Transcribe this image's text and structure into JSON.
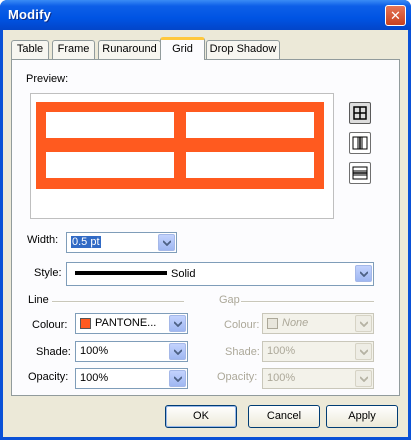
{
  "window": {
    "title": "Modify",
    "close_glyph": "✕"
  },
  "tabs": [
    {
      "label": "Table"
    },
    {
      "label": "Frame"
    },
    {
      "label": "Runaround"
    },
    {
      "label": "Grid"
    },
    {
      "label": "Drop Shadow"
    }
  ],
  "active_tab": "Grid",
  "preview": {
    "label": "Preview:",
    "grid_color": "#ff5a1f"
  },
  "width": {
    "label": "Width:",
    "value": "0.5 pt"
  },
  "style": {
    "label": "Style:",
    "value": "Solid"
  },
  "line": {
    "section_label": "Line",
    "colour": {
      "label": "Colour:",
      "value": "PANTONE...",
      "swatch": "#ff5a1f"
    },
    "shade": {
      "label": "Shade:",
      "value": "100%"
    },
    "opacity": {
      "label": "Opacity:",
      "value": "100%"
    }
  },
  "gap": {
    "section_label": "Gap",
    "colour": {
      "label": "Colour:",
      "value": "None"
    },
    "shade": {
      "label": "Shade:",
      "value": "100%"
    },
    "opacity": {
      "label": "Opacity:",
      "value": "100%"
    }
  },
  "buttons": {
    "ok": "OK",
    "cancel": "Cancel",
    "apply": "Apply"
  }
}
